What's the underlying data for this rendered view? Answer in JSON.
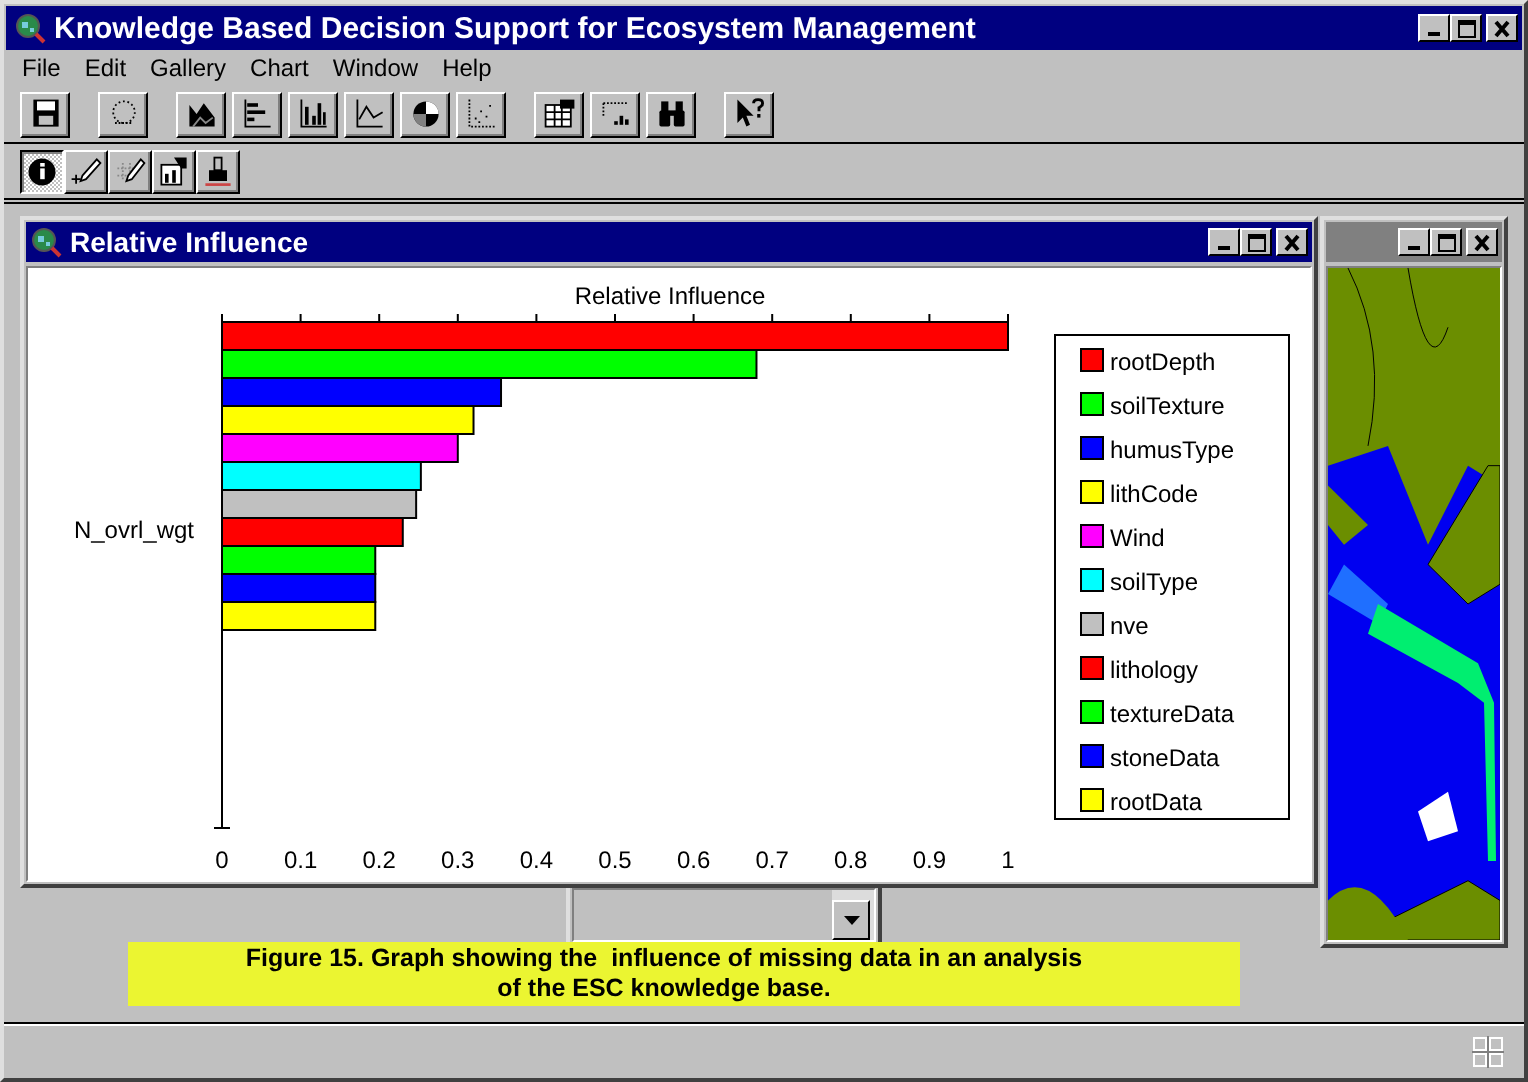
{
  "window": {
    "title": "Knowledge Based Decision Support for Ecosystem Management"
  },
  "menu": [
    "File",
    "Edit",
    "Gallery",
    "Chart",
    "Window",
    "Help"
  ],
  "toolbar": [
    [
      {
        "kind": "save"
      }
    ],
    [
      {
        "kind": "lasso"
      }
    ],
    [
      {
        "kind": "area"
      },
      {
        "kind": "hbar"
      },
      {
        "kind": "vbar"
      },
      {
        "kind": "line"
      },
      {
        "kind": "pie"
      },
      {
        "kind": "scatter"
      }
    ],
    [
      {
        "kind": "table"
      },
      {
        "kind": "grid"
      },
      {
        "kind": "binoculars"
      }
    ],
    [
      {
        "kind": "help"
      }
    ]
  ],
  "toolbar_2": [
    {
      "kind": "info",
      "selected": true
    },
    {
      "kind": "pen-add",
      "selected": false
    },
    {
      "kind": "pen-grid",
      "selected": false
    },
    {
      "kind": "export",
      "selected": false
    },
    {
      "kind": "brush",
      "selected": false
    }
  ],
  "windows": [
    {
      "kind": "list"
    },
    {
      "kind": "map",
      "active": false
    },
    {
      "kind": "chart",
      "active": true,
      "title": "Relative Influence",
      "chart_data": {
        "type": "bar",
        "orientation": "horizontal",
        "legend": "right",
        "title": "Relative Influence",
        "ylabel": "N_ovrl_wgt",
        "xlim": [
          0,
          1
        ],
        "xticks": [
          0,
          0.1,
          0.2,
          0.3,
          0.4,
          0.5,
          0.6,
          0.7,
          0.8,
          0.9,
          1
        ],
        "series": [
          {
            "name": "rootDepth",
            "color": "#ff0000",
            "values": [
              1.0
            ]
          },
          {
            "name": "soilTexture",
            "color": "#00ff00",
            "values": [
              0.68
            ]
          },
          {
            "name": "humusType",
            "color": "#0000ff",
            "values": [
              0.355
            ]
          },
          {
            "name": "lithCode",
            "color": "#ffff00",
            "values": [
              0.32
            ]
          },
          {
            "name": "Wind",
            "color": "#ff00ff",
            "values": [
              0.3
            ]
          },
          {
            "name": "soilType",
            "color": "#00ffff",
            "values": [
              0.253
            ]
          },
          {
            "name": "nve",
            "color": "#c0c0c0",
            "values": [
              0.247
            ]
          },
          {
            "name": "lithology",
            "color": "#ff0000",
            "values": [
              0.23
            ]
          },
          {
            "name": "textureData",
            "color": "#00ff00",
            "values": [
              0.195
            ]
          },
          {
            "name": "stoneData",
            "color": "#0000ff",
            "values": [
              0.195
            ]
          },
          {
            "name": "rootData",
            "color": "#ffff00",
            "values": [
              0.195
            ]
          }
        ]
      }
    }
  ],
  "caption": {
    "lines": [
      "Figure 15. Graph showing the  influence of missing data in an analysis",
      "of the ESC knowledge base."
    ]
  }
}
